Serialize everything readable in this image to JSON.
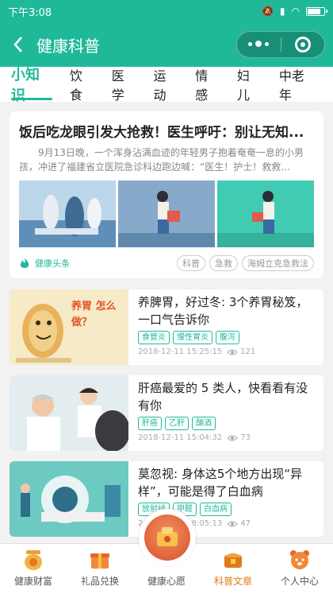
{
  "statusbar": {
    "time": "下午3:08"
  },
  "navbar": {
    "title": "健康科普"
  },
  "tabs": [
    "小知识",
    "饮食",
    "医学",
    "运动",
    "情感",
    "妇儿",
    "中老年"
  ],
  "featured": {
    "title": "饭后吃龙眼引发大抢救！医生呼吁：别让无知...",
    "summary": "9月13日晚，一个浑身沾满血迹的年轻男子抱着奄奄一息的小男孩，冲进了福建省立医院急诊科边跑边喊：“医生！护士！救救...",
    "source": "健康头条",
    "tags": [
      "科普",
      "急救",
      "海姆立克急救法"
    ]
  },
  "articles": [
    {
      "title": "养脾胃，好过冬: 3个养胃秘笈，一口气告诉你",
      "tags": [
        "食管炎",
        "慢性胃炎",
        "腹泻"
      ],
      "date": "2018-12-11 15:25:15",
      "views": "121",
      "thumb_text": "养胃 怎么做？"
    },
    {
      "title": "肝癌最爱的 5 类人，快看看有没有你",
      "tags": [
        "肝癌",
        "乙肝",
        "酗酒"
      ],
      "date": "2018-12-11 15:04:32",
      "views": "73"
    },
    {
      "title": "莫忽视: 身体这5个地方出现“异样”，可能是得了白血病",
      "tags": [
        "放射线",
        "甲醛",
        "白血病"
      ],
      "date": "2018-12-10 18:05:13",
      "views": "47"
    }
  ],
  "bottom_nav": [
    "健康财富",
    "礼品兑换",
    "健康心愿",
    "科普文章",
    "个人中心"
  ],
  "colors": {
    "accent": "#1fb99a",
    "active_tab": "#e07a1a"
  }
}
